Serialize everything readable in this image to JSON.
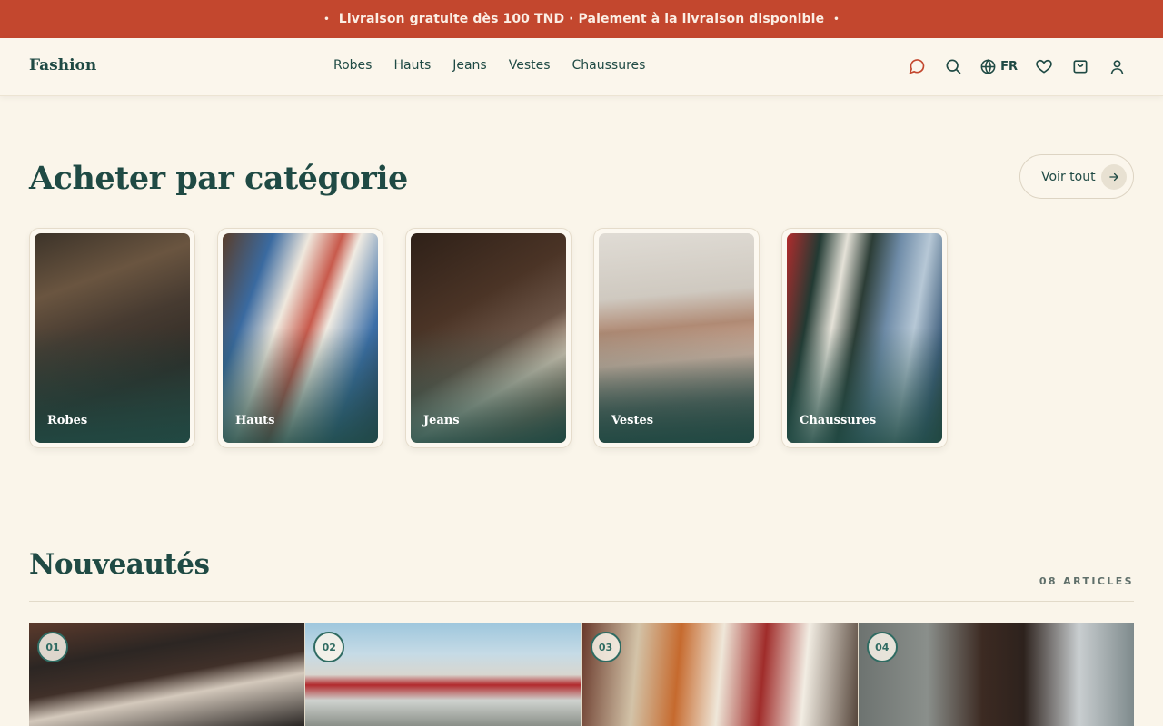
{
  "announcement": {
    "text": "Livraison gratuite dès 100 TND · Paiement à la livraison disponible",
    "bullet": "•"
  },
  "header": {
    "logo": "Fashion",
    "nav": [
      "Robes",
      "Hauts",
      "Jeans",
      "Vestes",
      "Chaussures"
    ],
    "language": "FR",
    "icons": [
      "chat-icon",
      "search-icon",
      "globe-icon",
      "heart-icon",
      "bag-icon",
      "user-icon"
    ]
  },
  "categories": {
    "title": "Acheter par catégorie",
    "see_all": "Voir tout",
    "items": [
      {
        "label": "Robes"
      },
      {
        "label": "Hauts"
      },
      {
        "label": "Jeans"
      },
      {
        "label": "Vestes"
      },
      {
        "label": "Chaussures"
      }
    ]
  },
  "new_arrivals": {
    "title": "Nouveautés",
    "count": "08 ARTICLES",
    "items": [
      {
        "number": "01"
      },
      {
        "number": "02"
      },
      {
        "number": "03"
      },
      {
        "number": "04"
      }
    ]
  },
  "colors": {
    "accent": "#c3472e",
    "primary": "#1f4a44",
    "background": "#faf5ea"
  }
}
